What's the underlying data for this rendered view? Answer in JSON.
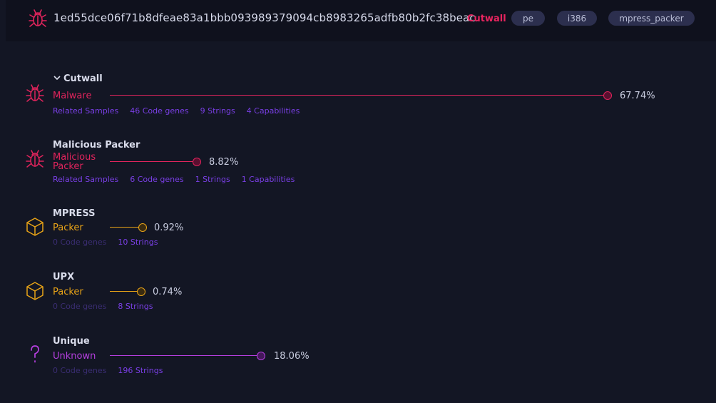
{
  "header": {
    "hash": "1ed55dce06f71b8dfeae83a1bbb093989379094cb8983265adfb80b2fc38beac",
    "family": "Cutwall",
    "tags": [
      "pe",
      "i386",
      "mpress_packer"
    ]
  },
  "colors": {
    "malware": "#e0245c",
    "packer": "#e8a317",
    "unknown": "#b63fe0",
    "link": "#7a3fe6",
    "link_dim": "#3a2d72",
    "background": "#131624"
  },
  "rows": [
    {
      "title": "Cutwall",
      "expanded": true,
      "icon": "bug-icon",
      "category": "Malware",
      "percent": "67.74%",
      "fraction": 0.6774,
      "links": [
        "Related Samples",
        "46 Code genes",
        "9 Strings",
        "4 Capabilities"
      ]
    },
    {
      "title": "Malicious Packer",
      "icon": "bug-icon",
      "category": "Malicious Packer",
      "percent": "8.82%",
      "fraction": 0.0882,
      "links": [
        "Related Samples",
        "6 Code genes",
        "1 Strings",
        "1 Capabilities"
      ]
    },
    {
      "title": "MPRESS",
      "icon": "box-icon",
      "category": "Packer",
      "percent": "0.92%",
      "fraction": 0.0092,
      "links": [
        "0 Code genes",
        "10 Strings"
      ]
    },
    {
      "title": "UPX",
      "icon": "box-icon",
      "category": "Packer",
      "percent": "0.74%",
      "fraction": 0.0074,
      "links": [
        "0 Code genes",
        "8 Strings"
      ]
    },
    {
      "title": "Unique",
      "icon": "question-icon",
      "category": "Unknown",
      "percent": "18.06%",
      "fraction": 0.1806,
      "links": [
        "0 Code genes",
        "196 Strings"
      ]
    }
  ]
}
